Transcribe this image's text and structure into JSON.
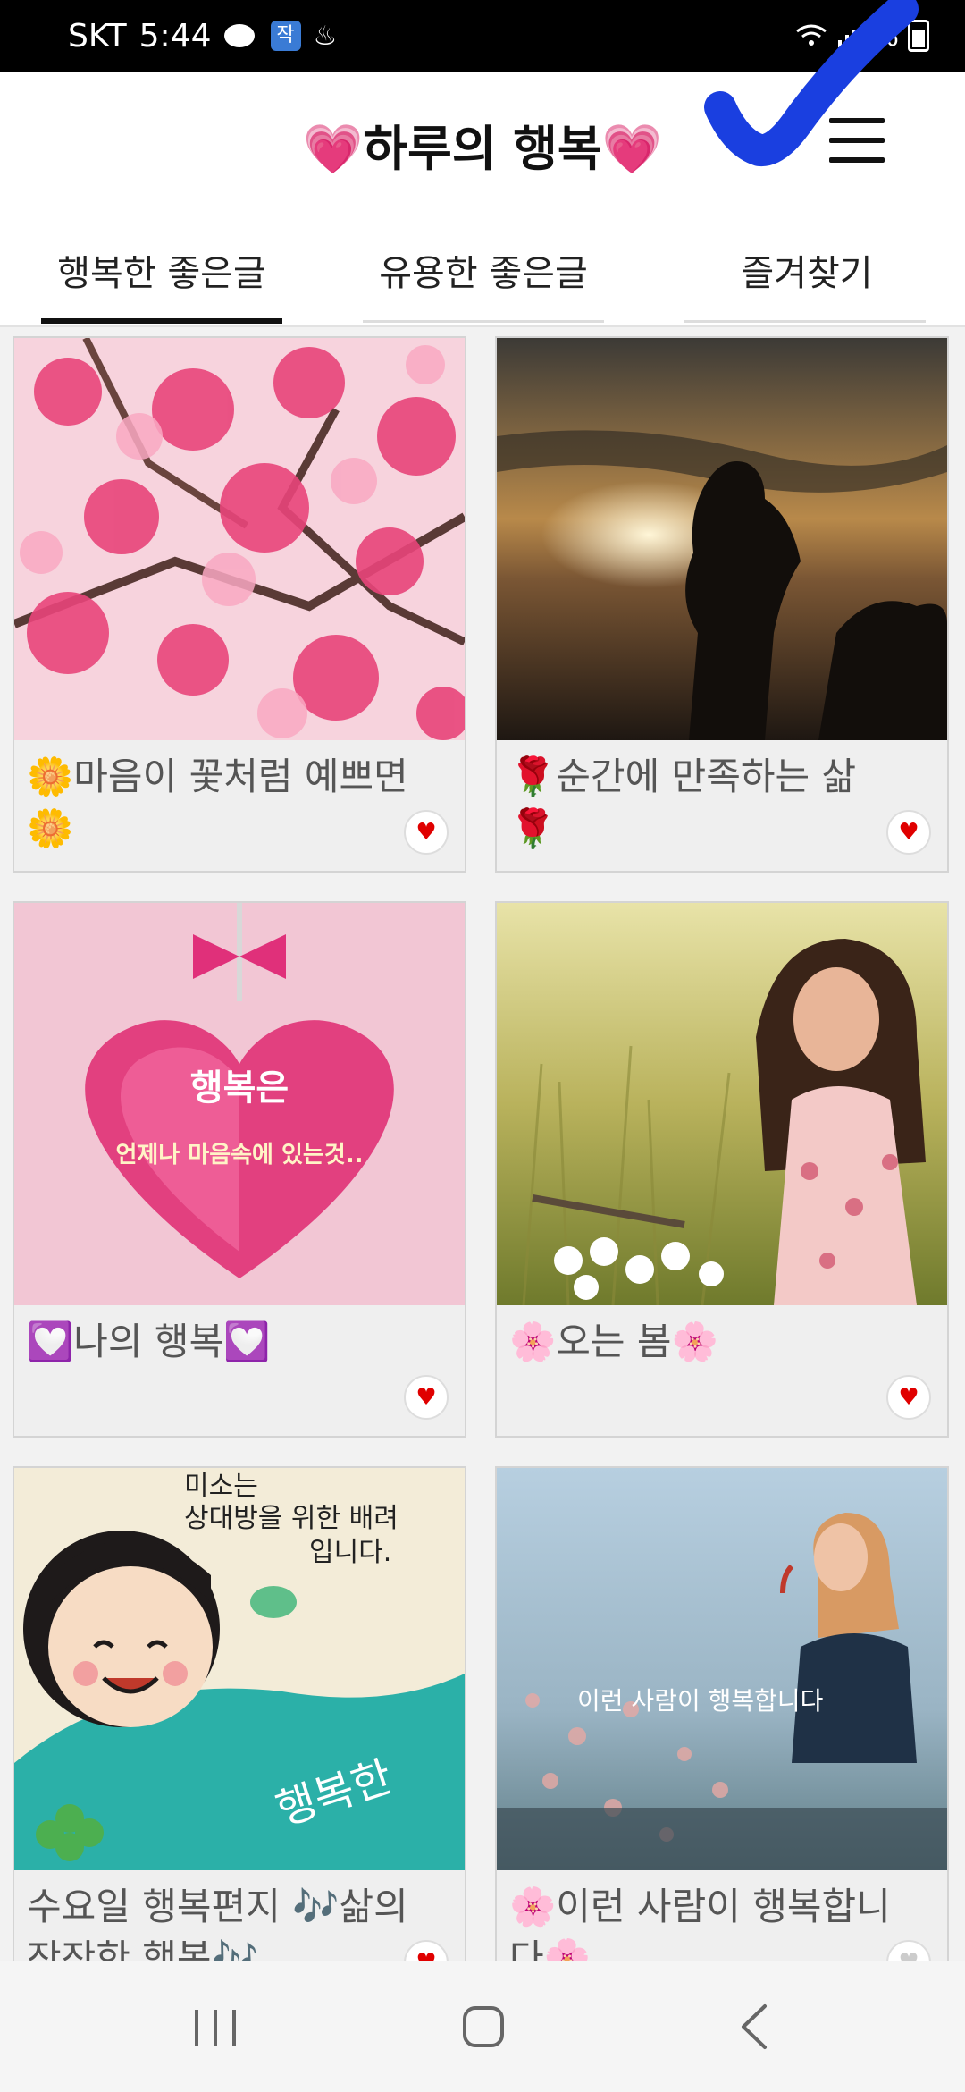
{
  "status_bar": {
    "carrier": "SKT",
    "time": "5:44",
    "app_badge": "작",
    "battery_text": "%"
  },
  "header": {
    "title": "💗하루의 행복💗"
  },
  "tabs": [
    {
      "label": "행복한 좋은글",
      "active": true
    },
    {
      "label": "유용한 좋은글",
      "active": false
    },
    {
      "label": "즐겨찾기",
      "active": false
    }
  ],
  "cards": [
    {
      "title": "🌼마음이 꽃처럼 예쁘면🌼",
      "image": "magnolia-blossoms"
    },
    {
      "title": "🌹순간에 만족하는 삶🌹",
      "image": "sunset-silhouette"
    },
    {
      "title": "💟나의 행복💟",
      "image": "pink-heart-jewel",
      "image_text_1": "행복은",
      "image_text_2": "언제나 마음속에 있는것.."
    },
    {
      "title": "🌸오는 봄🌸",
      "image": "woman-in-field"
    },
    {
      "title": "수요일 행복편지 🎶삶의 잔잔한 행복🎶",
      "image": "smiling-girl-cartoon",
      "image_text_1": "미소는",
      "image_text_2": "상대방을 위한 배려",
      "image_text_3": "입니다.",
      "image_text_4": "행복한"
    },
    {
      "title": "🌸이런 사람이 행복합니다🌸",
      "image": "woman-with-flower",
      "image_text_1": "이런 사람이 행복합니다"
    }
  ],
  "icons": {
    "menu": "hamburger-menu-icon",
    "favorite": "heart-icon",
    "nav_recent": "recent-apps-icon",
    "nav_home": "home-icon",
    "nav_back": "back-icon"
  },
  "colors": {
    "accent_heart": "#e00000",
    "checkmark": "#1a3fe0",
    "tab_active": "#111111"
  }
}
